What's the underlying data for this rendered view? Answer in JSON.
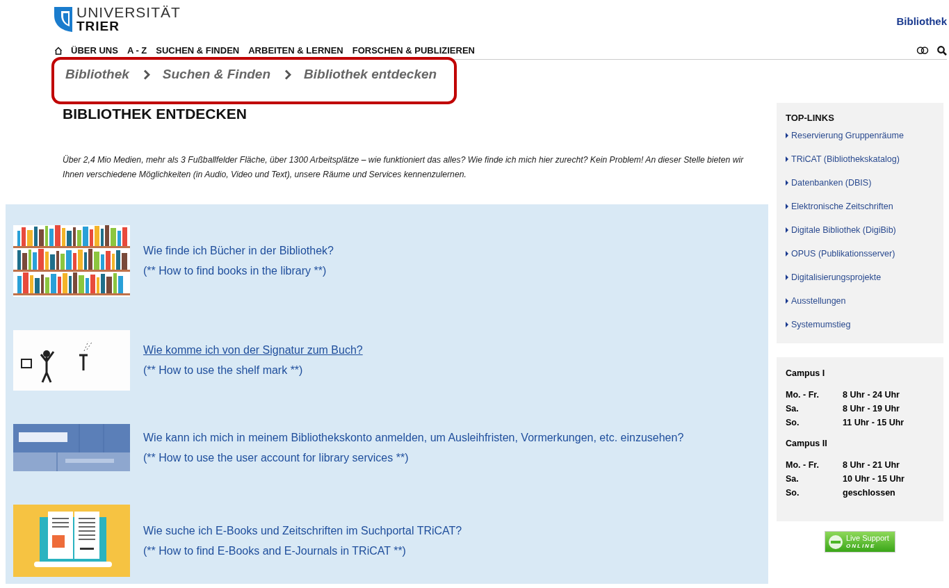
{
  "header": {
    "logo": {
      "line_1": "UNIVERSITÄT",
      "line_2": "TRIER"
    },
    "site_title": "Bibliothek"
  },
  "nav": {
    "items": [
      {
        "label": "ÜBER UNS"
      },
      {
        "label": "A - Z"
      },
      {
        "label": "SUCHEN & FINDEN"
      },
      {
        "label": "ARBEITEN & LERNEN"
      },
      {
        "label": "FORSCHEN & PUBLIZIEREN"
      }
    ]
  },
  "breadcrumb": {
    "highlighted": true,
    "items": [
      "Bibliothek",
      "Suchen & Finden",
      "Bibliothek entdecken"
    ]
  },
  "heading": "BIBLIOTHEK ENTDECKEN",
  "intro": "Über 2,4 Mio Medien, mehr als 3 Fußballfelder Fläche, über 1300 Arbeitsplätze – wie funktioniert das alles? Wie finde ich mich hier zurecht?  Kein Problem! An dieser Stelle bieten wir Ihnen verschiedene Möglichkeiten (in Audio, Video und Text), unsere Räume und Services kennenzulernen.",
  "guides": [
    {
      "kind": "bookshelf",
      "title": "Wie finde ich Bücher in der Bibliothek?",
      "subtitle": "(** How to find books in the library **)",
      "underlined": false
    },
    {
      "kind": "sketch",
      "title": "Wie komme ich von der Signatur zum Buch?",
      "subtitle": "(** How to use the shelf mark **)",
      "underlined": true
    },
    {
      "kind": "screenshot",
      "title": "Wie kann ich mich in meinem Bibliothekskonto anmelden, um Ausleihfristen, Vormerkungen, etc. einzusehen?",
      "subtitle": "(** How to use the user account for library services **)",
      "underlined": false
    },
    {
      "kind": "ebook",
      "title": "Wie suche ich E-Books und Zeitschriften im Suchportal TRiCAT?",
      "subtitle": "(** How to find E-Books and E-Journals in TRiCAT **)",
      "underlined": false
    }
  ],
  "sidebar": {
    "top_links": {
      "title": "TOP-LINKS",
      "links": [
        "Reservierung Gruppenräume",
        "TRiCAT (Bibliothekskatalog)",
        "Datenbanken (DBIS)",
        "Elektronische Zeitschriften",
        "Digitale Bibliothek (DigiBib)",
        "OPUS (Publikationsserver)",
        "Digitalisierungsprojekte",
        "Ausstellungen",
        "Systemumstieg"
      ]
    },
    "opening_hours": [
      {
        "campus": "Campus I",
        "rows": [
          {
            "days": "Mo. - Fr.",
            "hours": "8 Uhr - 24 Uhr"
          },
          {
            "days": "Sa.",
            "hours": "8 Uhr - 19 Uhr"
          },
          {
            "days": "So.",
            "hours": "11 Uhr - 15 Uhr"
          }
        ]
      },
      {
        "campus": "Campus II",
        "rows": [
          {
            "days": "Mo. - Fr.",
            "hours": "8 Uhr - 21 Uhr"
          },
          {
            "days": "Sa.",
            "hours": "10 Uhr - 15 Uhr"
          },
          {
            "days": "So.",
            "hours": "geschlossen"
          }
        ]
      }
    ],
    "live_support": {
      "label": "Live Support",
      "status": "ONLINE"
    }
  }
}
